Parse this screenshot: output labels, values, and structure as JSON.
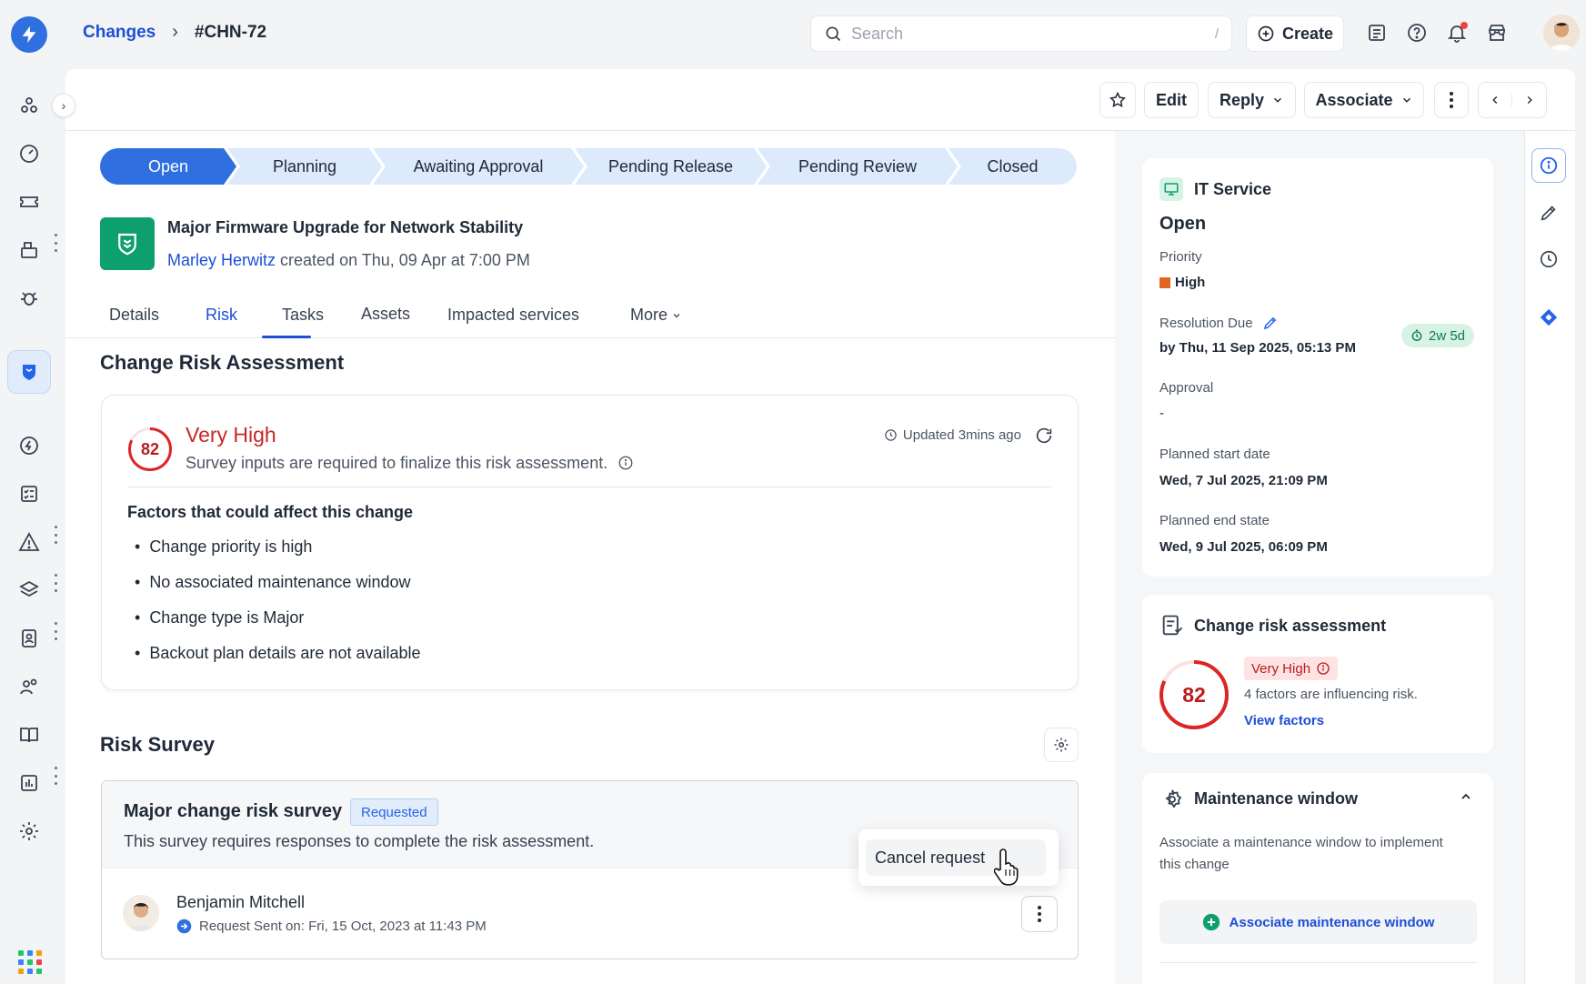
{
  "breadcrumb": {
    "parent": "Changes",
    "current": "#CHN-72"
  },
  "search": {
    "placeholder": "Search",
    "shortcut": "/"
  },
  "header": {
    "create_label": "Create"
  },
  "toolbar": {
    "edit": "Edit",
    "reply": "Reply",
    "associate": "Associate"
  },
  "stepper": [
    "Open",
    "Planning",
    "Awaiting Approval",
    "Pending Release",
    "Pending Review",
    "Closed"
  ],
  "change": {
    "title": "Major Firmware Upgrade for Network Stability",
    "author": "Marley Herwitz",
    "created": "created on Thu, 09 Apr at 7:00 PM"
  },
  "tabs": [
    "Details",
    "Risk",
    "Tasks",
    "Assets",
    "Impacted services",
    "More"
  ],
  "risk_assessment": {
    "section_title": "Change Risk Assessment",
    "score": "82",
    "level": "Very High",
    "description": "Survey inputs are required to finalize this risk assessment.",
    "updated": "Updated 3mins ago",
    "factors_title": "Factors that could affect this change",
    "factors": [
      "Change priority is high",
      "No associated maintenance window",
      "Change type is Major",
      "Backout plan details are not available"
    ]
  },
  "survey": {
    "section_title": "Risk Survey",
    "title": "Major change risk survey",
    "badge": "Requested",
    "description": "This survey requires responses to complete the risk assessment.",
    "person": "Benjamin Mitchell",
    "sent": "Request Sent on: Fri, 15 Oct, 2023 at 11:43 PM",
    "menu_item": "Cancel request"
  },
  "sidebar_info": {
    "type": "IT Service",
    "status": "Open",
    "priority_label": "Priority",
    "priority": "High",
    "priority_color": "#e0661f",
    "resolution_label": "Resolution Due",
    "resolution": "by Thu, 11 Sep 2025, 05:13 PM",
    "time_left": "2w 5d",
    "approval_label": "Approval",
    "approval": "-",
    "start_label": "Planned start date",
    "start": "Wed, 7 Jul 2025, 21:09 PM",
    "end_label": "Planned end state",
    "end": "Wed, 9 Jul 2025, 06:09 PM"
  },
  "risk_card": {
    "title": "Change risk assessment",
    "score": "82",
    "level": "Very High",
    "desc": "4 factors are influencing risk.",
    "link": "View factors"
  },
  "maintenance": {
    "title": "Maintenance window",
    "desc_line1": "Associate a maintenance window to implement",
    "desc_line2": "this change",
    "button": "Associate maintenance window"
  },
  "colors": {
    "accent": "#2f6fe0",
    "danger": "#dc2626",
    "success": "#0e9f6e"
  }
}
